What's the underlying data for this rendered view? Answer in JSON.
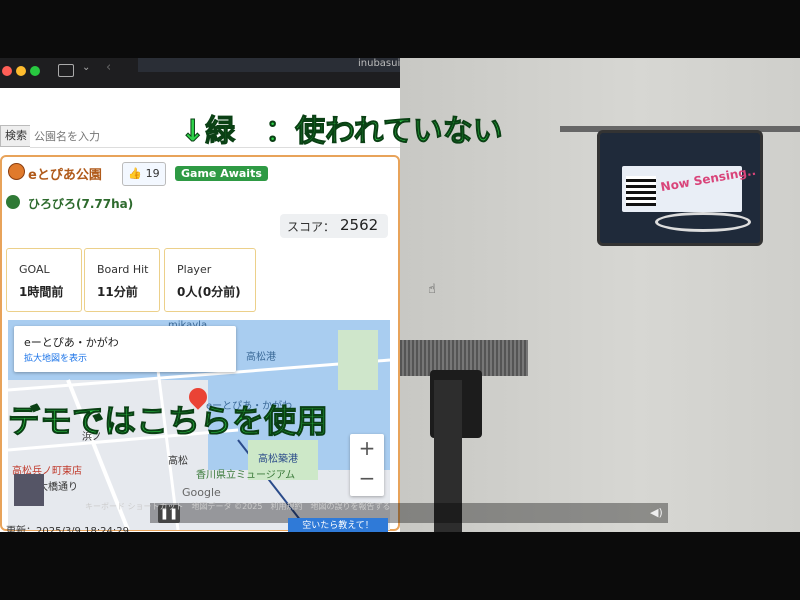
{
  "browser": {
    "url_fragment": "inubasui"
  },
  "search": {
    "button_label": "検索",
    "placeholder": "公園名を入力"
  },
  "park": {
    "name": "eとぴあ公園",
    "like_count": "👍 19",
    "status_badge": "Game Awaits",
    "area": "ひろびろ(7.77ha)",
    "score_label": "スコア：",
    "score_value": "2562"
  },
  "stats": [
    {
      "label": "GOAL",
      "value": "1時間前"
    },
    {
      "label": "Board Hit",
      "value": "11分前"
    },
    {
      "label": "Player",
      "value": "0人(0分前)"
    }
  ],
  "map": {
    "card_title": "eーとぴあ・かがわ",
    "card_link": "拡大地図を表示",
    "labels": [
      "mikayla",
      "高松港",
      "eーとぴあ・かがわ",
      "高松",
      "香川県立ミュージアム",
      "高松築港",
      "高松兵ノ町東店",
      "大橋通り",
      "浜ノ"
    ],
    "zoom_in": "+",
    "zoom_out": "−",
    "google": "Google",
    "footer": "キーボード ショートカット　地図データ ©2025　利用規約　地図の誤りを報告する",
    "share_button": "空いたら教えて！"
  },
  "footer_text": "更新：2025/3/9 18:24:29",
  "video": {
    "board_text": "Now Sensing..",
    "pause_icon": "❚❚",
    "volume_icon": "◀)"
  },
  "captions": {
    "top": "↓緑　：使われていない",
    "bottom": "デモではこちらを使用"
  },
  "colors": {
    "caption_green": "#2fd34a",
    "badge_green": "#2e9a44",
    "card_border": "#e8a35a"
  }
}
